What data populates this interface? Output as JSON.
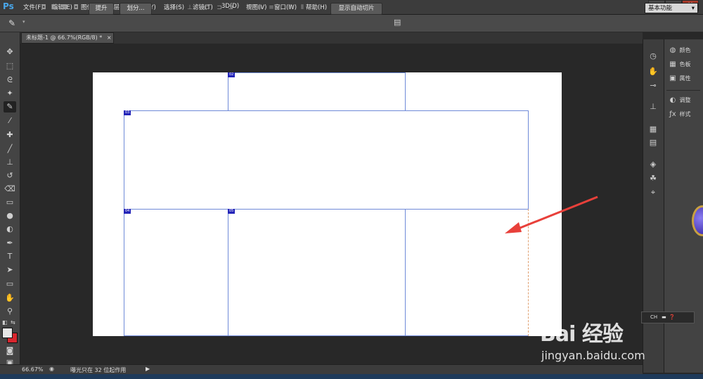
{
  "app": {
    "logo": "Ps",
    "menu": [
      "文件(F)",
      "编辑(E)",
      "图像(I)",
      "图层(L)",
      "文字(Y)",
      "选择(S)",
      "滤镜(T)",
      "3D(D)",
      "视图(V)",
      "窗口(W)",
      "帮助(H)"
    ],
    "window_buttons": [
      "_",
      "▫",
      "✕"
    ]
  },
  "options_bar": {
    "promote_label": "提升",
    "divide_label": "划分...",
    "show_auto_slices_label": "显示自动切片",
    "workspace": "基本功能"
  },
  "document": {
    "tab_title": "未标题-1 @ 66.7%(RGB/8) *",
    "tab_close": "×"
  },
  "slices": {
    "badges": [
      "02",
      "03",
      "04",
      "05",
      "06"
    ]
  },
  "right_panel": {
    "items": [
      "颜色",
      "色板",
      "属性",
      "调整",
      "样式"
    ]
  },
  "status": {
    "zoom": "66.67%",
    "message": "曝光只在 32 位起作用"
  },
  "ime": {
    "lang": "CH"
  },
  "watermark": {
    "brand": "Bai 经验",
    "url": "jingyan.baidu.com"
  },
  "colors": {
    "accent": "#49a6e9",
    "slice_border": "#6f8ad8",
    "slice_badge": "#2324b8",
    "arrow": "#e8403a",
    "foreground_swatch": "#e6e6e6",
    "background_swatch": "#d8262e"
  }
}
